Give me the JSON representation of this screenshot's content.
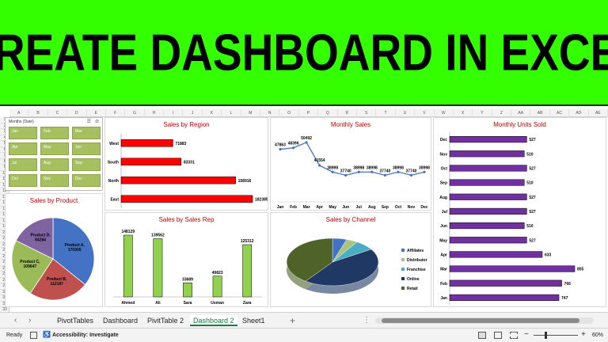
{
  "banner": {
    "title": "CREATE DASHBOARD IN EXCEL"
  },
  "columns": [
    "A",
    "B",
    "C",
    "D",
    "E",
    "F",
    "G",
    "H",
    "I",
    "J",
    "K",
    "L",
    "M",
    "N",
    "O",
    "P",
    "Q",
    "R",
    "S",
    "T",
    "U",
    "V",
    "W",
    "X",
    "Y",
    "Z",
    "AA",
    "AB",
    "AC",
    "AD",
    "AE"
  ],
  "rows": [
    "1",
    "2",
    "3",
    "4",
    "5",
    "6",
    "7",
    "8",
    "9",
    "10",
    "11",
    "12",
    "13",
    "14",
    "15",
    "16",
    "17",
    "18",
    "19",
    "20",
    "21",
    "22",
    "23",
    "24",
    "25",
    "26",
    "27",
    "28",
    "29",
    "30",
    "31",
    "32",
    "33"
  ],
  "slicer": {
    "title": "Months (Date)",
    "items": [
      "Jan",
      "Feb",
      "Mar",
      "Apr",
      "May",
      "Jun",
      "Jul",
      "Aug",
      "Sep",
      "Oct",
      "Nov",
      "Dec"
    ]
  },
  "tabs": [
    "PivotTables",
    "Dashboard",
    "PivitTable 2",
    "Dashboard 2",
    "Sheet1"
  ],
  "active_tab": "Dashboard 2",
  "status": {
    "ready": "Ready",
    "accessibility": "Accessibility: Investigate",
    "zoom": "60%"
  },
  "colors": {
    "banner": "#33ff00",
    "bars_red": "#ff0000",
    "bars_green": "#92d050",
    "bars_purple": "#7030a0",
    "line": "#4472c4",
    "title": "#c00000"
  },
  "chart_data": [
    {
      "type": "bar",
      "orientation": "horizontal",
      "title": "Sales by Region",
      "categories": [
        "West",
        "South",
        "North",
        "East"
      ],
      "values": [
        71883,
        83331,
        158916,
        182385
      ]
    },
    {
      "type": "line",
      "title": "Monthly Sales",
      "categories": [
        "Jan",
        "Feb",
        "Mar",
        "Apr",
        "May",
        "Jun",
        "Jul",
        "Aug",
        "Sep",
        "Oct",
        "Nov",
        "Dec"
      ],
      "values": [
        47863,
        48396,
        50492,
        41554,
        38998,
        37740,
        38998,
        38998,
        37740,
        38998,
        37740,
        38998
      ]
    },
    {
      "type": "bar",
      "orientation": "horizontal",
      "title": "Monthly Units Sold",
      "categories": [
        "Dec",
        "Nov",
        "Oct",
        "Sep",
        "Aug",
        "Jul",
        "Jun",
        "May",
        "Apr",
        "Mar",
        "Feb",
        "Jan"
      ],
      "values": [
        527,
        510,
        527,
        510,
        527,
        527,
        510,
        527,
        633,
        855,
        766,
        747
      ]
    },
    {
      "type": "pie",
      "title": "Sales by Product",
      "categories": [
        "Product A",
        "Product B",
        "Product C",
        "Product D"
      ],
      "labels": [
        "Product A, 170305",
        "Product B, 112187",
        "Product C, 109647",
        "Product D, 84284"
      ],
      "values": [
        170305,
        112187,
        109647,
        84284
      ]
    },
    {
      "type": "bar",
      "title": "Sales by Sales Rep",
      "categories": [
        "Ahmed",
        "Ali",
        "Sara",
        "Usman",
        "Zara"
      ],
      "values": [
        148129,
        139562,
        33689,
        49823,
        125312
      ]
    },
    {
      "type": "pie",
      "title": "Sales by Channel",
      "categories": [
        "Affiliates",
        "Distributor",
        "Franchise",
        "Online",
        "Retail"
      ],
      "values": [
        5,
        4,
        7,
        44,
        40
      ],
      "colors": [
        "#4472c4",
        "#a9c47f",
        "#4bacc6",
        "#1f3864",
        "#4f6228"
      ]
    }
  ]
}
